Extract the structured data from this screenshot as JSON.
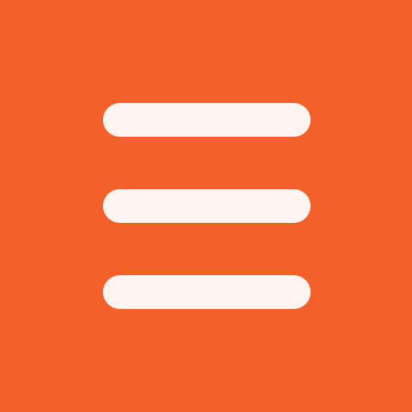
{
  "icon": {
    "name": "hamburger-menu-icon",
    "background_color": "#F4602A",
    "bar_color": "#FDF4F1",
    "bars": 3
  }
}
